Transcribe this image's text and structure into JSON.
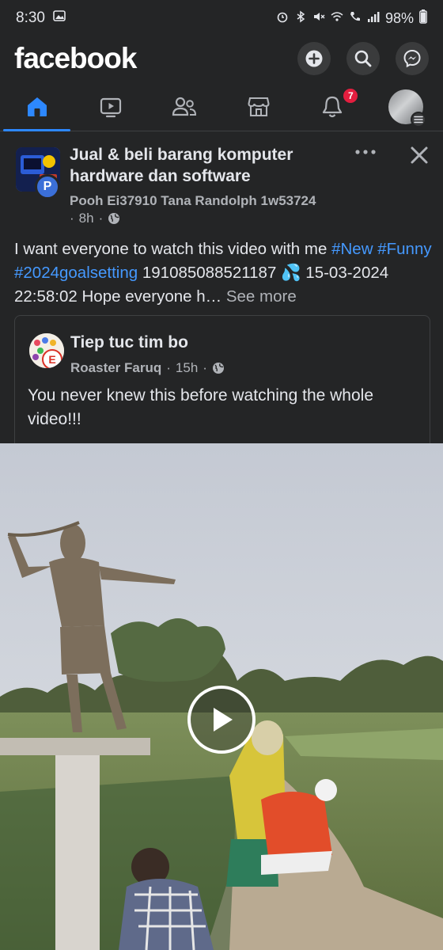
{
  "status_bar": {
    "time": "8:30",
    "battery": "98%"
  },
  "header": {
    "logo": "facebook",
    "icons": [
      "add-icon",
      "search-icon",
      "messenger-icon"
    ]
  },
  "nav": {
    "tabs": [
      "home",
      "video",
      "friends",
      "marketplace",
      "notifications",
      "profile-menu"
    ],
    "active_tab": "home",
    "notifications_badge": "7"
  },
  "post": {
    "group_name": "Jual & beli barang komputer hardware dan software",
    "group_avatar_letter": "P",
    "author": "Pooh Ei37910 Tana  Randolph 1w53724",
    "time": "8h",
    "audience": "public",
    "text_before": "I want everyone to watch this video with me ",
    "tags": [
      "#New",
      "#Funny",
      "#2024goalsetting"
    ],
    "text_number": " 191085088521187 ",
    "emoji": "💦",
    "text_after": " 15-03-2024 22:58:02 Hope everyone h…",
    "see_more": "See more"
  },
  "shared": {
    "page_name": "Tiep tuc tim bo",
    "avatar_letter": "E",
    "author": "Roaster Faruq",
    "time": "15h",
    "text": "You never knew this before watching the whole video!!!"
  },
  "video": {
    "state": "paused"
  },
  "colors": {
    "background": "#242526",
    "link": "#4599ff",
    "accent": "#2d88ff",
    "badge": "#e41e3f"
  }
}
